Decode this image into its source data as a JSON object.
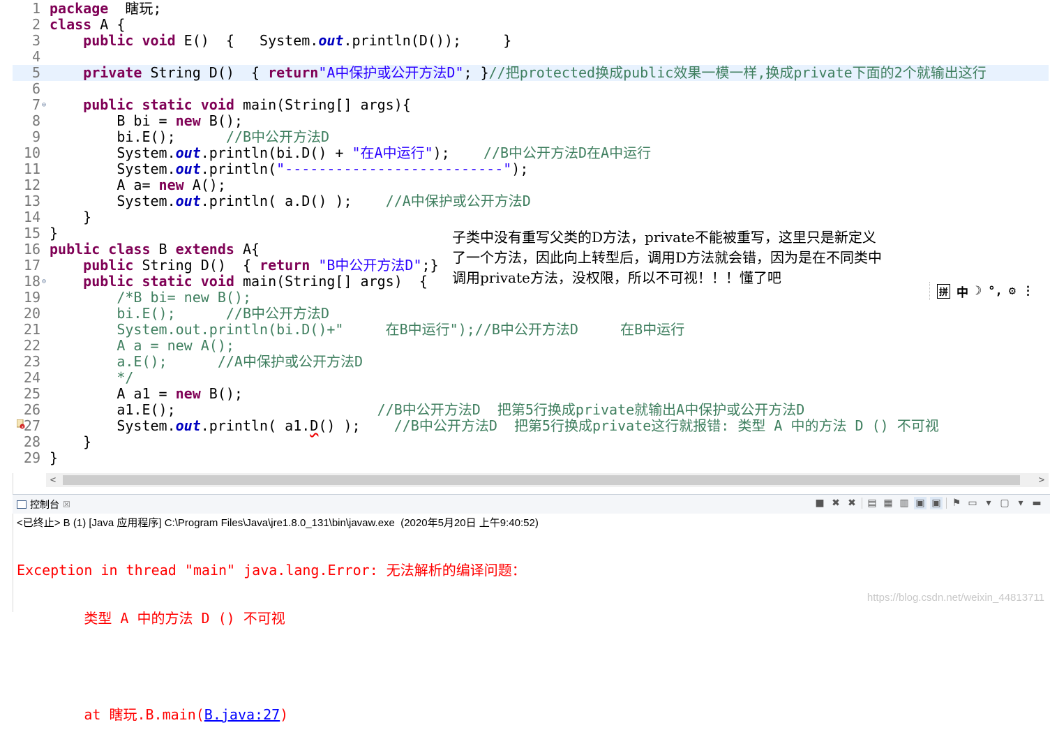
{
  "editor": {
    "lines": [
      {
        "n": "1",
        "parts": [
          [
            "kw",
            "package"
          ],
          [
            "",
            "  瞎玩;"
          ]
        ]
      },
      {
        "n": "2",
        "parts": [
          [
            "kw",
            "class"
          ],
          [
            "",
            " A {"
          ]
        ]
      },
      {
        "n": "3",
        "parts": [
          [
            "",
            "    "
          ],
          [
            "kw",
            "public void"
          ],
          [
            "",
            " E()  {   System."
          ],
          [
            "it",
            "out"
          ],
          [
            "",
            ".println(D());     }"
          ]
        ]
      },
      {
        "n": "4",
        "parts": []
      },
      {
        "n": "5",
        "parts": [
          [
            "",
            "    "
          ],
          [
            "kw",
            "private"
          ],
          [
            "",
            " String D()  { "
          ],
          [
            "kw",
            "return"
          ],
          [
            "str",
            "\"A中保护或公开方法D\""
          ],
          [
            "",
            "; }"
          ],
          [
            "cm",
            "//把protected换成public效果一模一样,换成private下面的2个就输出这行"
          ]
        ]
      },
      {
        "n": "6",
        "parts": []
      },
      {
        "n": "7",
        "parts": [
          [
            "",
            "    "
          ],
          [
            "kw",
            "public static void"
          ],
          [
            "",
            " main(String[] args){"
          ]
        ]
      },
      {
        "n": "8",
        "parts": [
          [
            "",
            "        B bi = "
          ],
          [
            "kw",
            "new"
          ],
          [
            "",
            " B();"
          ]
        ]
      },
      {
        "n": "9",
        "parts": [
          [
            "",
            "        bi.E();      "
          ],
          [
            "cm",
            "//B中公开方法D"
          ]
        ]
      },
      {
        "n": "10",
        "parts": [
          [
            "",
            "        System."
          ],
          [
            "it",
            "out"
          ],
          [
            "",
            ".println(bi.D() + "
          ],
          [
            "str",
            "\"在A中运行\""
          ],
          [
            "",
            ");    "
          ],
          [
            "cm",
            "//B中公开方法D在A中运行"
          ]
        ]
      },
      {
        "n": "11",
        "parts": [
          [
            "",
            "        System."
          ],
          [
            "it",
            "out"
          ],
          [
            "",
            ".println("
          ],
          [
            "str",
            "\"--------------------------\""
          ],
          [
            "",
            ");"
          ]
        ]
      },
      {
        "n": "12",
        "parts": [
          [
            "",
            "        A a= "
          ],
          [
            "kw",
            "new"
          ],
          [
            "",
            " A();"
          ]
        ]
      },
      {
        "n": "13",
        "parts": [
          [
            "",
            "        System."
          ],
          [
            "it",
            "out"
          ],
          [
            "",
            ".println( a.D() );    "
          ],
          [
            "cm",
            "//A中保护或公开方法D"
          ]
        ]
      },
      {
        "n": "14",
        "parts": [
          [
            "",
            "    }"
          ]
        ]
      },
      {
        "n": "15",
        "parts": [
          [
            "",
            "}"
          ]
        ]
      },
      {
        "n": "16",
        "parts": [
          [
            "kw",
            "public class"
          ],
          [
            "",
            " B "
          ],
          [
            "kw",
            "extends"
          ],
          [
            "",
            " A{"
          ]
        ]
      },
      {
        "n": "17",
        "parts": [
          [
            "",
            "    "
          ],
          [
            "kw",
            "public"
          ],
          [
            "",
            " String D()  { "
          ],
          [
            "kw",
            "return"
          ],
          [
            "str",
            " \"B中公开方法D\""
          ],
          [
            "",
            ";}"
          ]
        ]
      },
      {
        "n": "18",
        "parts": [
          [
            "",
            "    "
          ],
          [
            "kw",
            "public static void"
          ],
          [
            "",
            " main(String[] args)  {"
          ]
        ]
      },
      {
        "n": "19",
        "parts": [
          [
            "",
            "        "
          ],
          [
            "cm",
            "/*B bi= new B();"
          ]
        ]
      },
      {
        "n": "20",
        "parts": [
          [
            "",
            "        "
          ],
          [
            "cm",
            "bi.E();      //B中公开方法D"
          ]
        ]
      },
      {
        "n": "21",
        "parts": [
          [
            "",
            "        "
          ],
          [
            "cm",
            "System.out.println(bi.D()+\"     在B中运行\");//B中公开方法D     在B中运行"
          ]
        ]
      },
      {
        "n": "22",
        "parts": [
          [
            "",
            "        "
          ],
          [
            "cm",
            "A a = new A();"
          ]
        ]
      },
      {
        "n": "23",
        "parts": [
          [
            "",
            "        "
          ],
          [
            "cm",
            "a.E();      //A中保护或公开方法D"
          ]
        ]
      },
      {
        "n": "24",
        "parts": [
          [
            "",
            "        "
          ],
          [
            "cm",
            "*/"
          ]
        ]
      },
      {
        "n": "25",
        "parts": [
          [
            "",
            "        A a1 = "
          ],
          [
            "kw",
            "new"
          ],
          [
            "",
            " B();"
          ]
        ]
      },
      {
        "n": "26",
        "parts": [
          [
            "",
            "        a1.E();                        "
          ],
          [
            "cm",
            "//B中公开方法D  把第5行换成private就输出A中保护或公开方法D"
          ]
        ]
      },
      {
        "n": "27",
        "parts": [
          [
            "",
            "        System."
          ],
          [
            "it",
            "out"
          ],
          [
            "",
            ".println( a1."
          ],
          [
            "errword",
            "D"
          ],
          [
            "",
            "() );    "
          ],
          [
            "cm",
            "//B中公开方法D  把第5行换成private这行就报错: 类型 A 中的方法 D () 不可视"
          ]
        ]
      },
      {
        "n": "28",
        "parts": [
          [
            "",
            "    }"
          ]
        ]
      },
      {
        "n": "29",
        "parts": [
          [
            "",
            "}"
          ]
        ]
      }
    ]
  },
  "annotation": {
    "line1": "子类中没有重写父类的D方法，private不能被重写，这里只是新定义",
    "line2": "了一个方法，因此向上转型后，调用D方法就会错，因为是在不同类中",
    "line3": "调用private方法，没权限，所以不可视！！！懂了吧"
  },
  "ime": {
    "pinyin": "拼",
    "lang": "中",
    "moon": "☽",
    "punct": "°,",
    "settings": "⚙",
    "more": "⋮"
  },
  "console": {
    "tab_label": "控制台",
    "tab_close": "☒",
    "status": "<已终止> B (1) [Java 应用程序] C:\\Program Files\\Java\\jre1.8.0_131\\bin\\javaw.exe  (2020年5月20日 上午9:40:52)",
    "out_line1": "Exception in thread \"main\" java.lang.Error: 无法解析的编译问题：",
    "out_line2": "        类型 A 中的方法 D () 不可视",
    "out_line3_prefix": "        at 瞎玩.B.main(",
    "out_line3_link": "B.java:27",
    "out_line3_suffix": ")"
  },
  "scroll": {
    "left_arrow": "<",
    "right_arrow": ">"
  },
  "watermark": "https://blog.csdn.net/weixin_44813711"
}
